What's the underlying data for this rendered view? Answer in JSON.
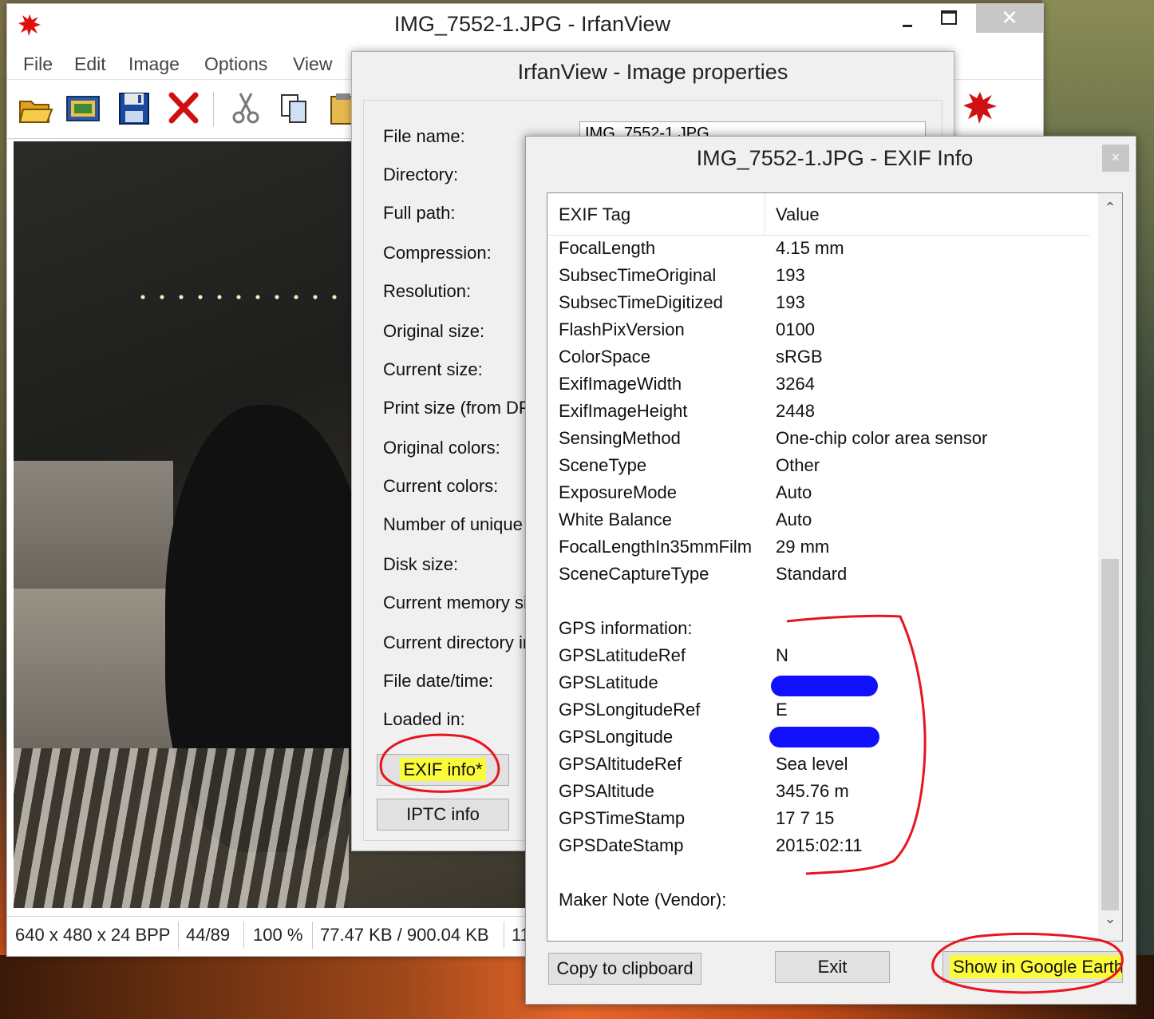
{
  "main_window": {
    "title": "IMG_7552-1.JPG - IrfanView",
    "close_glyph": "✕",
    "menu": [
      "File",
      "Edit",
      "Image",
      "Options",
      "View"
    ],
    "toolbar_icons": [
      "open-folder-icon",
      "thumbnails-icon",
      "save-icon",
      "delete-icon",
      "cut-icon",
      "copy-icon",
      "paste-icon",
      "irfanview-logo-icon"
    ],
    "status": [
      "640 x 480 x 24 BPP",
      "44/89",
      "100 %",
      "77.47 KB / 900.04 KB",
      "11"
    ]
  },
  "properties_window": {
    "title": "IrfanView - Image properties",
    "file_name_value": "IMG_7552-1.JPG",
    "labels": [
      "File name:",
      "Directory:",
      "Full path:",
      "Compression:",
      "Resolution:",
      "Original size:",
      "Current size:",
      "Print size (from DPI",
      "Original colors:",
      "Current colors:",
      "Number of unique c",
      "Disk size:",
      "Current memory siz",
      "Current directory in",
      "File date/time:",
      "Loaded in:"
    ],
    "exif_button": "EXIF info*",
    "iptc_button": "IPTC info"
  },
  "exif_window": {
    "title": "IMG_7552-1.JPG - EXIF Info",
    "close_glyph": "×",
    "col_tag": "EXIF Tag",
    "col_value": "Value",
    "rows": [
      {
        "tag": "FocalLength",
        "value": "4.15 mm"
      },
      {
        "tag": "SubsecTimeOriginal",
        "value": "193"
      },
      {
        "tag": "SubsecTimeDigitized",
        "value": "193"
      },
      {
        "tag": "FlashPixVersion",
        "value": "0100"
      },
      {
        "tag": "ColorSpace",
        "value": "sRGB"
      },
      {
        "tag": "ExifImageWidth",
        "value": "3264"
      },
      {
        "tag": "ExifImageHeight",
        "value": "2448"
      },
      {
        "tag": "SensingMethod",
        "value": "One-chip color area sensor"
      },
      {
        "tag": "SceneType",
        "value": "Other"
      },
      {
        "tag": "ExposureMode",
        "value": "Auto"
      },
      {
        "tag": "White Balance",
        "value": "Auto"
      },
      {
        "tag": "FocalLengthIn35mmFilm",
        "value": "29 mm"
      },
      {
        "tag": "SceneCaptureType",
        "value": "Standard"
      },
      {
        "tag": "",
        "value": ""
      },
      {
        "tag": "GPS information:",
        "value": ""
      },
      {
        "tag": "GPSLatitudeRef",
        "value": "N"
      },
      {
        "tag": "GPSLatitude",
        "value": ""
      },
      {
        "tag": "GPSLongitudeRef",
        "value": "E"
      },
      {
        "tag": "GPSLongitude",
        "value": ""
      },
      {
        "tag": "GPSAltitudeRef",
        "value": "Sea level"
      },
      {
        "tag": "GPSAltitude",
        "value": "345.76 m"
      },
      {
        "tag": "GPSTimeStamp",
        "value": "17  7  15"
      },
      {
        "tag": "GPSDateStamp",
        "value": "2015:02:11"
      },
      {
        "tag": "",
        "value": ""
      },
      {
        "tag": "Maker Note (Vendor):",
        "value": ""
      }
    ],
    "copy_button": "Copy to clipboard",
    "exit_button": "Exit",
    "google_earth_button": "Show in Google Earth",
    "scroll_up_glyph": "⌃",
    "scroll_down_glyph": "⌄"
  },
  "colors": {
    "annotation_red": "#e8141e",
    "highlight_yellow": "#fbfb3a",
    "redaction_blue": "#1010ff"
  }
}
